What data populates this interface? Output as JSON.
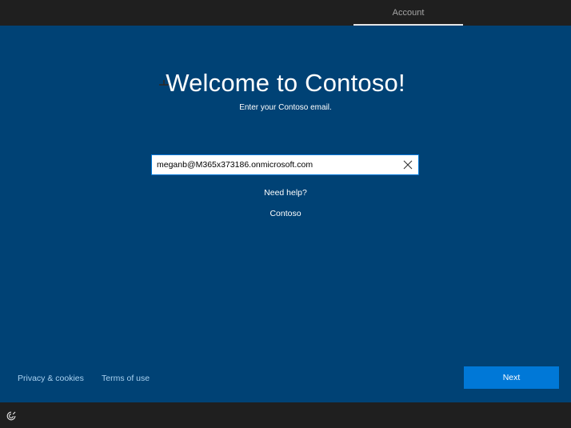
{
  "header": {
    "tab_label": "Account"
  },
  "main": {
    "title": "Welcome to Contoso!",
    "subtitle": "Enter your Contoso email.",
    "email_value": "meganb@M365x373186.onmicrosoft.com",
    "need_help": "Need help?",
    "org_link": "Contoso"
  },
  "footer": {
    "privacy": "Privacy & cookies",
    "terms": "Terms of use",
    "next_label": "Next"
  },
  "icons": {
    "pin": "pushpin-icon",
    "clear": "close-icon",
    "ease_of_access": "ease-of-access-icon"
  },
  "colors": {
    "background": "#004275",
    "accent": "#0078d7",
    "link": "#a8d1f0",
    "bar": "#1f1f1f"
  }
}
